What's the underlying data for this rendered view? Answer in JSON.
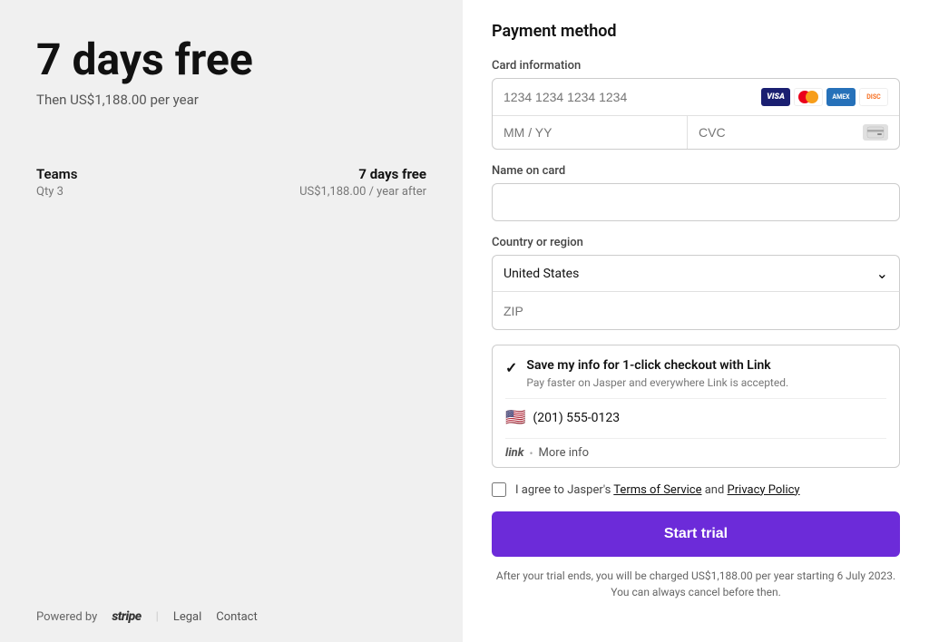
{
  "left": {
    "main_title": "7 days free",
    "subtitle": "Then US$1,188.00 per year",
    "plan": {
      "name": "Teams",
      "qty": "Qty 3",
      "trial_label": "7 days free",
      "price_after": "US$1,188.00 / year after"
    },
    "footer": {
      "powered_by": "Powered by",
      "stripe": "stripe",
      "legal": "Legal",
      "contact": "Contact"
    }
  },
  "right": {
    "section_title": "Payment method",
    "card_info": {
      "label": "Card information",
      "card_number_placeholder": "1234 1234 1234 1234",
      "mm_yy_placeholder": "MM / YY",
      "cvc_placeholder": "CVC"
    },
    "name_on_card": {
      "label": "Name on card",
      "placeholder": ""
    },
    "country_region": {
      "label": "Country or region",
      "selected": "United States",
      "zip_placeholder": "ZIP"
    },
    "link_save": {
      "title": "Save my info for 1-click checkout with Link",
      "description": "Pay faster on Jasper and everywhere Link is accepted.",
      "phone": "(201) 555-0123",
      "link_label": "link",
      "more_info": "More info"
    },
    "terms": {
      "text_before": "I agree to Jasper's ",
      "terms_label": "Terms of Service",
      "text_mid": " and ",
      "privacy_label": "Privacy Policy"
    },
    "start_trial_btn": "Start trial",
    "trial_note": "After your trial ends, you will be charged US$1,188.00 per year starting 6 July 2023. You can always cancel before then."
  }
}
